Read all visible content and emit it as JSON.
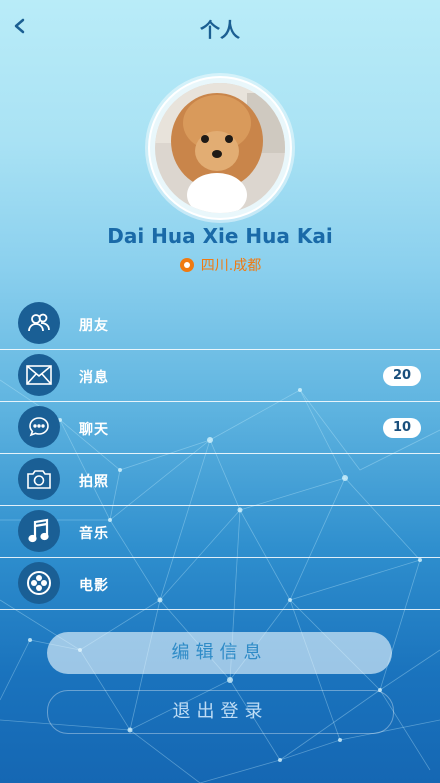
{
  "header": {
    "title": "个人"
  },
  "profile": {
    "name": "Dai Hua Xie Hua Kai",
    "location": "四川.成都"
  },
  "menu": {
    "items": [
      {
        "label": "朋友",
        "icon": "friends-icon"
      },
      {
        "label": "消息",
        "icon": "mail-icon",
        "badge": "20"
      },
      {
        "label": "聊天",
        "icon": "chat-icon",
        "badge": "10"
      },
      {
        "label": "拍照",
        "icon": "camera-icon"
      },
      {
        "label": "音乐",
        "icon": "music-icon"
      },
      {
        "label": "电影",
        "icon": "film-reel-icon"
      }
    ]
  },
  "actions": {
    "edit_label": "编辑信息",
    "logout_label": "退出登录"
  },
  "colors": {
    "title": "#1b5f92",
    "name": "#1a6aa8",
    "location": "#f07a11",
    "icon_circle": "#1a5f95"
  }
}
